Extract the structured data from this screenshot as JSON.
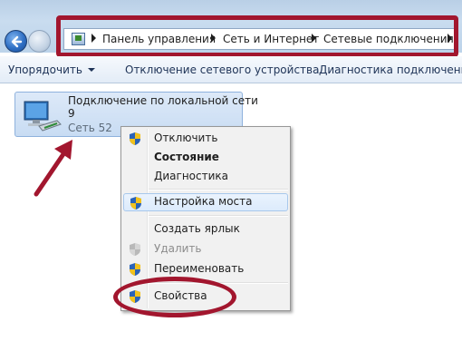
{
  "colors": {
    "annotation": "#a2162e",
    "menu_hover": "#dcebfc"
  },
  "nav": {
    "back_icon": "arrow-left-icon",
    "forward_icon": "arrow-right-icon"
  },
  "address": {
    "breadcrumbs": [
      "Панель управления",
      "Сеть и Интернет",
      "Сетевые подключения"
    ]
  },
  "toolbar": {
    "organize": "Упорядочить",
    "disable_device": "Отключение сетевого устройства",
    "diagnose": "Диагностика подключения"
  },
  "connection": {
    "name_line1": "Подключение по локальной сети",
    "name_line2": "9",
    "status": "Сеть  52"
  },
  "context_menu": {
    "disable": "Отключить",
    "status": "Состояние",
    "diagnostics": "Диагностика",
    "bridge": "Настройка моста",
    "shortcut": "Создать ярлык",
    "delete": "Удалить",
    "rename": "Переименовать",
    "properties": "Свойства"
  }
}
